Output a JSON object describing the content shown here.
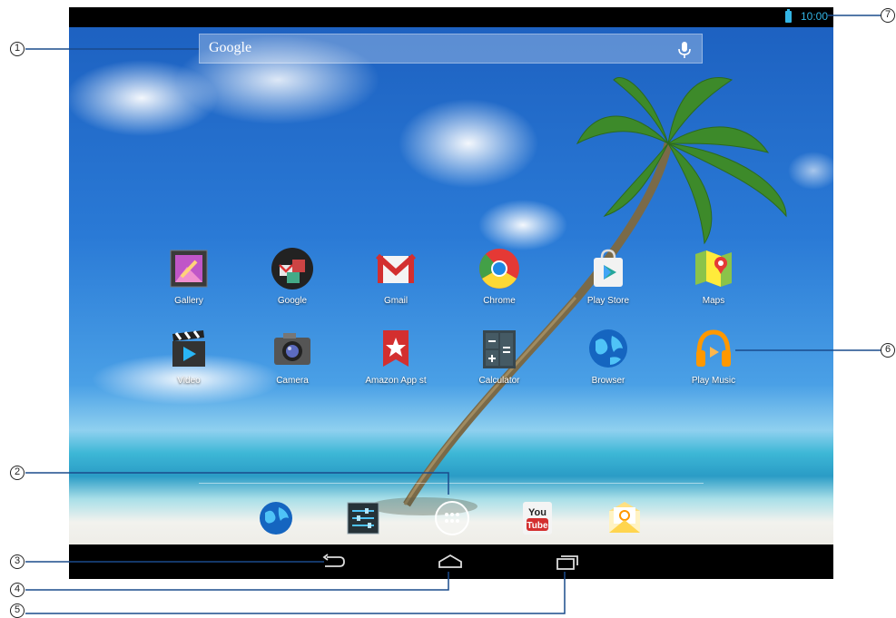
{
  "status_bar": {
    "time": "10:00",
    "battery_color": "#33b5e5"
  },
  "search": {
    "text": "Google",
    "mic_icon": "microphone-icon"
  },
  "apps": [
    {
      "label": "Gallery",
      "icon": "gallery-icon"
    },
    {
      "label": "Google",
      "icon": "google-folder-icon"
    },
    {
      "label": "Gmail",
      "icon": "gmail-icon"
    },
    {
      "label": "Chrome",
      "icon": "chrome-icon"
    },
    {
      "label": "Play Store",
      "icon": "play-store-icon"
    },
    {
      "label": "Maps",
      "icon": "maps-icon"
    },
    {
      "label": "Video",
      "icon": "video-icon"
    },
    {
      "label": "Camera",
      "icon": "camera-icon"
    },
    {
      "label": "Amazon App st",
      "icon": "amazon-appstore-icon"
    },
    {
      "label": "Calculator",
      "icon": "calculator-icon"
    },
    {
      "label": "Browser",
      "icon": "browser-icon"
    },
    {
      "label": "Play Music",
      "icon": "play-music-icon"
    }
  ],
  "dock": {
    "youtube_top": "You",
    "youtube_bottom": "Tube",
    "items": [
      "browser-icon",
      "settings-icon",
      "all-apps-icon",
      "youtube-icon",
      "email-icon"
    ]
  },
  "nav": {
    "items": [
      "back-icon",
      "home-icon",
      "recent-apps-icon"
    ]
  },
  "callouts": [
    "1",
    "2",
    "3",
    "4",
    "5",
    "6",
    "7"
  ]
}
